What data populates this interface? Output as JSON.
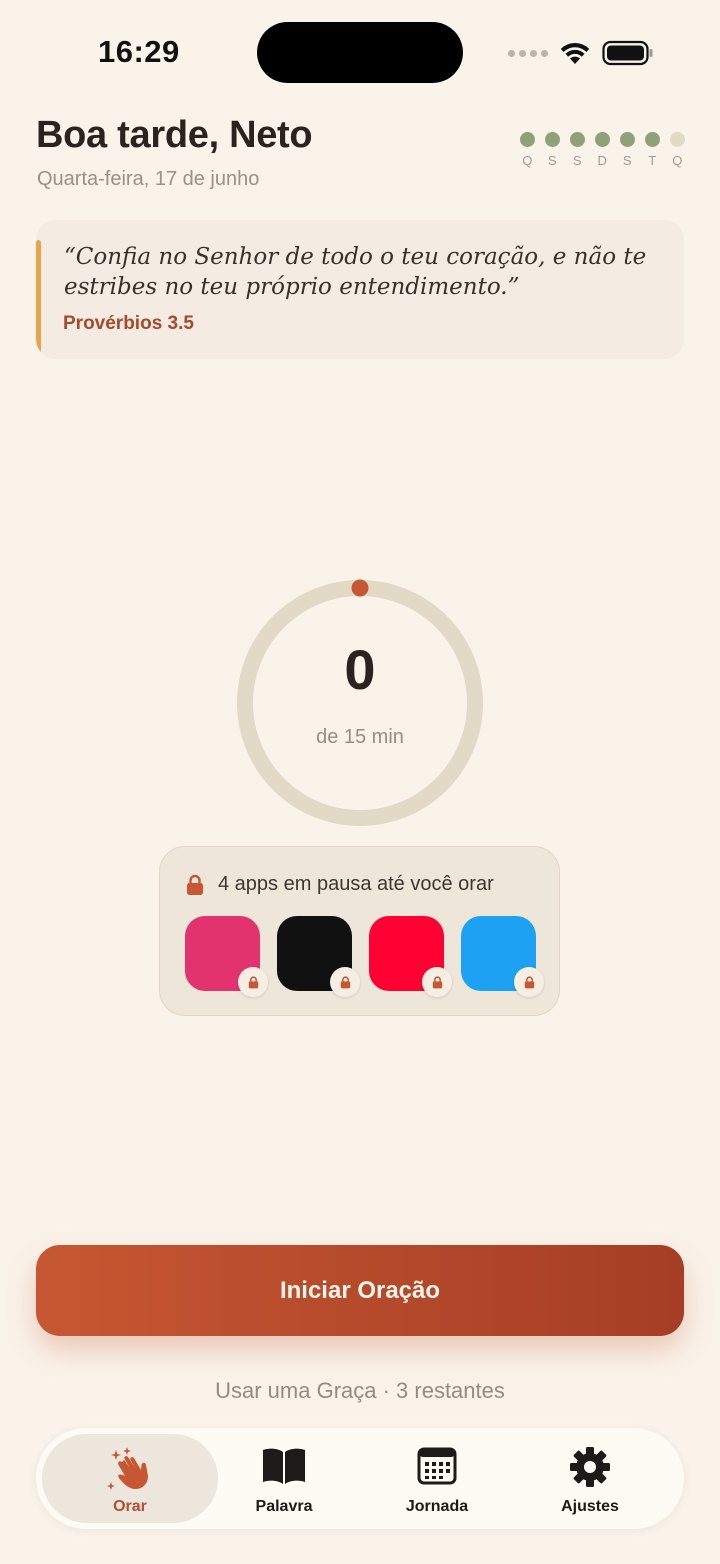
{
  "status_bar": {
    "time": "16:29"
  },
  "header": {
    "greeting": "Boa tarde, Neto",
    "date": "Quarta-feira, 17 de junho",
    "week": [
      {
        "label": "Q",
        "done": true
      },
      {
        "label": "S",
        "done": true
      },
      {
        "label": "S",
        "done": true
      },
      {
        "label": "D",
        "done": true
      },
      {
        "label": "S",
        "done": true
      },
      {
        "label": "T",
        "done": true
      },
      {
        "label": "Q",
        "done": false
      }
    ]
  },
  "verse": {
    "text": "“Confia no Senhor de todo o teu coração, e não te estribes no teu próprio entendimento.”",
    "reference": "Provérbios 3.5"
  },
  "progress": {
    "value": "0",
    "goal_label": "de 15 min",
    "fraction": 0
  },
  "blocked_apps": {
    "title": "4 apps em pausa até você orar",
    "apps": [
      {
        "color": "#E2336F"
      },
      {
        "color": "#111111"
      },
      {
        "color": "#FF0033"
      },
      {
        "color": "#1DA1F2"
      }
    ]
  },
  "cta": {
    "label": "Iniciar Oração"
  },
  "grace": {
    "label": "Usar uma Graça · 3 restantes"
  },
  "tabs": [
    {
      "label": "Orar",
      "icon": "praying-hands-icon",
      "active": true
    },
    {
      "label": "Palavra",
      "icon": "book-icon",
      "active": false
    },
    {
      "label": "Jornada",
      "icon": "calendar-icon",
      "active": false
    },
    {
      "label": "Ajustes",
      "icon": "gear-icon",
      "active": false
    }
  ],
  "colors": {
    "accent": "#B54E2D",
    "streak_done": "#8FA177",
    "streak_pending": "#E3D9C7",
    "verse_bar": "#E8A44A"
  }
}
